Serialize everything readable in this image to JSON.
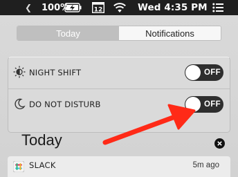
{
  "menubar": {
    "battery_percent": "100%",
    "calendar_day": "12",
    "clock": "Wed 4:35 PM"
  },
  "tabs": [
    {
      "label": "Today",
      "selected": true
    },
    {
      "label": "Notifications",
      "selected": false
    }
  ],
  "toggles": [
    {
      "label": "NIGHT SHIFT",
      "icon": "night-shift-icon",
      "state": "OFF"
    },
    {
      "label": "DO NOT DISTURB",
      "icon": "moon-icon",
      "state": "OFF"
    }
  ],
  "today_section": {
    "heading": "Today"
  },
  "notification": {
    "app": "SLACK",
    "icon": "slack-icon",
    "time": "5m ago"
  },
  "annotation": {
    "arrow_color": "#ff2a17"
  }
}
